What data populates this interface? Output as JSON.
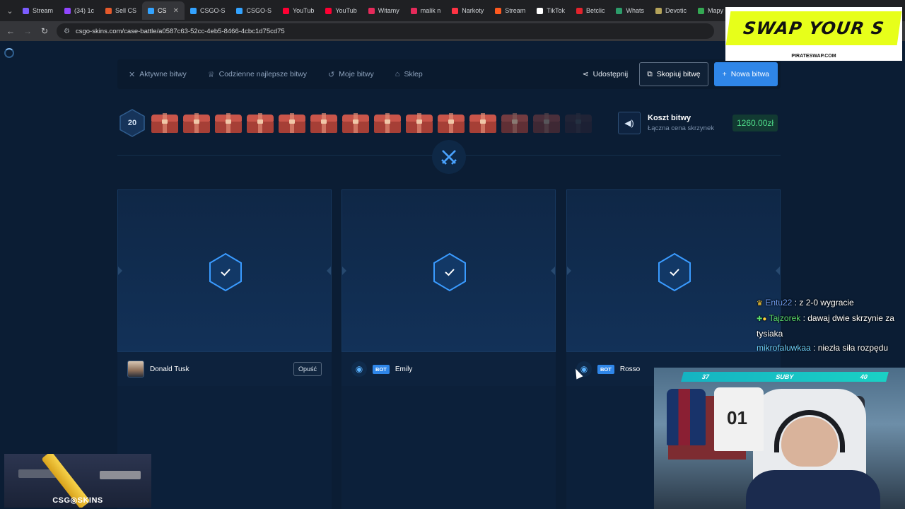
{
  "browser": {
    "tabs": [
      {
        "label": "Stream",
        "color": "#7b5cff"
      },
      {
        "label": "(34) 1c",
        "color": "#9146ff"
      },
      {
        "label": "Sell CS",
        "color": "#e65a2b"
      },
      {
        "label": "CS",
        "color": "#33a3ff",
        "active": true
      },
      {
        "label": "CSGO-S",
        "color": "#33a3ff"
      },
      {
        "label": "CSGO-S",
        "color": "#33a3ff"
      },
      {
        "label": "YouTub",
        "color": "#ff0033"
      },
      {
        "label": "YouTub",
        "color": "#ff0033"
      },
      {
        "label": "Witamy",
        "color": "#e52a5a"
      },
      {
        "label": "malik n",
        "color": "#e52a5a"
      },
      {
        "label": "Narkoty",
        "color": "#ff3344"
      },
      {
        "label": "Stream",
        "color": "#ff5a1f"
      },
      {
        "label": "TikTok",
        "color": "#ffffff"
      },
      {
        "label": "Betclic",
        "color": "#e3232c"
      },
      {
        "label": "Whats",
        "color": "#2c9c6a"
      },
      {
        "label": "Devotic",
        "color": "#b4a35a"
      },
      {
        "label": "Mapy G",
        "color": "#34a853"
      }
    ],
    "url": "csgo-skins.com/case-battle/a0587c63-52cc-4eb5-8466-4cbc1d75cd75"
  },
  "nav": {
    "items": [
      {
        "label": "Aktywne bitwy",
        "icon": "swords-icon"
      },
      {
        "label": "Codzienne najlepsze bitwy",
        "icon": "trophy-icon"
      },
      {
        "label": "Moje bitwy",
        "icon": "history-icon"
      },
      {
        "label": "Sklep",
        "icon": "shop-icon"
      }
    ],
    "share_label": "Udostępnij",
    "copy_label": "Skopiuj bitwę",
    "new_label": "Nowa bitwa"
  },
  "battle": {
    "rounds": "20",
    "case_count": 14,
    "cost_title": "Koszt bitwy",
    "cost_subtitle": "Łączna cena skrzynek",
    "price": "1260.00zł"
  },
  "players": [
    {
      "name": "Donald Tusk",
      "bot": false,
      "leave_label": "Opuść"
    },
    {
      "name": "Emily",
      "bot": true,
      "bot_label": "BOT"
    },
    {
      "name": "Rosso",
      "bot": true,
      "bot_label": "BOT"
    }
  ],
  "overlay": {
    "ad_headline": "SWAP YOUR S",
    "ad_site": "PIRATESWAP.COM",
    "chat": [
      {
        "user": "Entu22",
        "text": ": z 2-0 wygracie"
      },
      {
        "user": "Tajzorek",
        "text": ": dawaj dwie skrzynie za tysiaka"
      },
      {
        "user": "mikrofaluwkaa",
        "text": ": niezła siła rozpędu"
      }
    ],
    "subs_left": "37",
    "subs_label": "SUBY",
    "subs_right": "40",
    "logo_text": "CSG◎SKINS"
  }
}
